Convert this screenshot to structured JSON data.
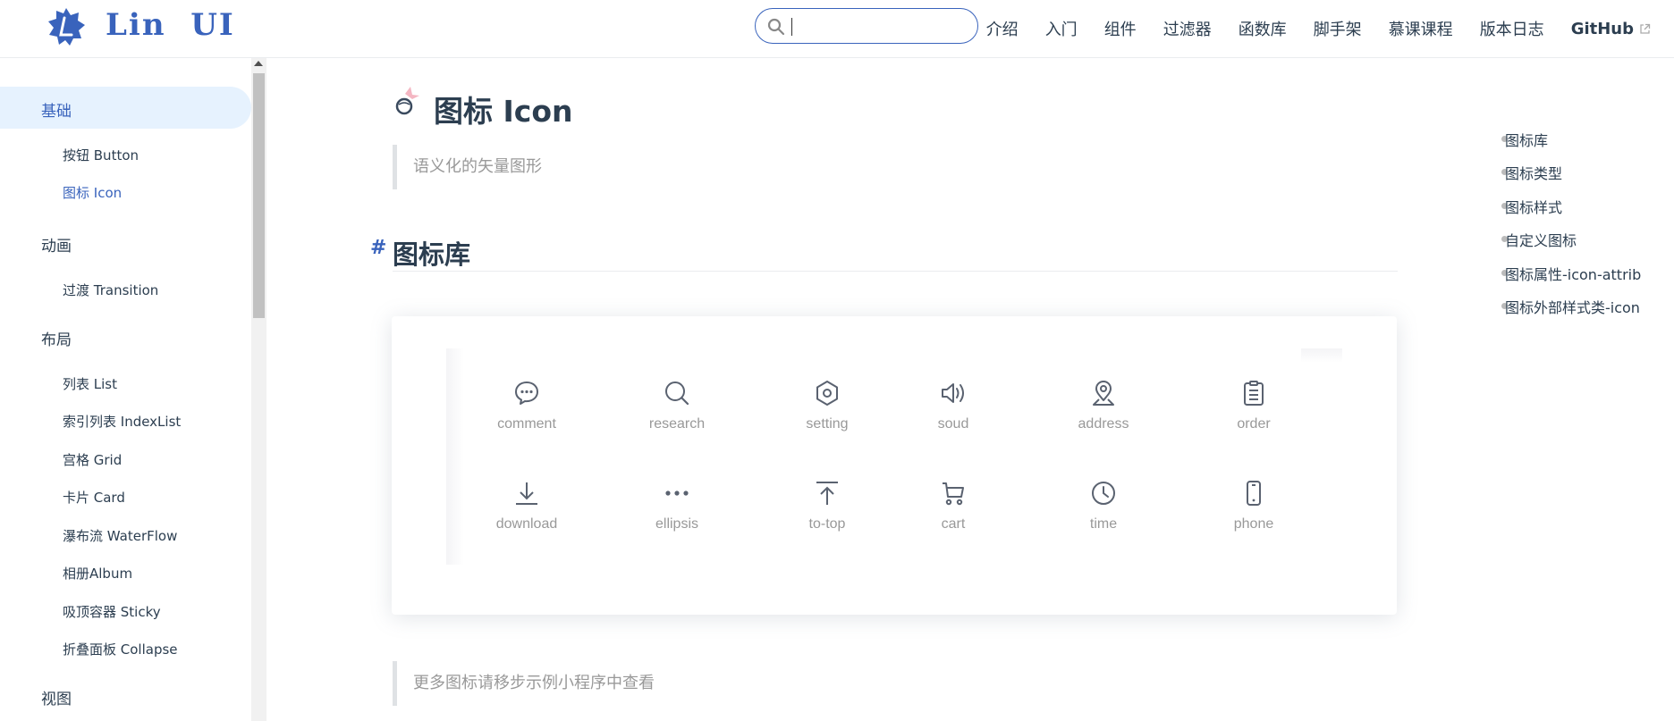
{
  "header": {
    "brand": "Lin  UI",
    "search": {
      "value": "",
      "placeholder": ""
    },
    "nav": [
      "介绍",
      "入门",
      "组件",
      "过滤器",
      "函数库",
      "脚手架",
      "慕课课程",
      "版本日志"
    ],
    "github_label": "GitHub"
  },
  "sidebar": {
    "groups": [
      {
        "title": "基础",
        "active": true,
        "items": [
          {
            "label": "按钮 Button"
          },
          {
            "label": "图标 Icon",
            "active": true
          }
        ]
      },
      {
        "title": "动画",
        "items": [
          {
            "label": "过渡 Transition"
          }
        ]
      },
      {
        "title": "布局",
        "items": [
          {
            "label": "列表 List"
          },
          {
            "label": "索引列表 IndexList"
          },
          {
            "label": "宫格 Grid"
          },
          {
            "label": "卡片 Card"
          },
          {
            "label": "瀑布流 WaterFlow"
          },
          {
            "label": "相册Album"
          },
          {
            "label": "吸顶容器 Sticky"
          },
          {
            "label": "折叠面板 Collapse"
          }
        ]
      },
      {
        "title": "视图",
        "items": []
      }
    ]
  },
  "main": {
    "title": "图标 Icon",
    "subtitle": "语义化的矢量图形",
    "section_hash": "#",
    "section_title": "图标库",
    "icons": [
      {
        "label": "comment",
        "icon": "comment-icon"
      },
      {
        "label": "research",
        "icon": "search-icon"
      },
      {
        "label": "setting",
        "icon": "setting-icon"
      },
      {
        "label": "soud",
        "icon": "sound-icon"
      },
      {
        "label": "address",
        "icon": "address-icon"
      },
      {
        "label": "order",
        "icon": "order-icon"
      },
      {
        "label": "download",
        "icon": "download-icon"
      },
      {
        "label": "ellipsis",
        "icon": "ellipsis-icon"
      },
      {
        "label": "to-top",
        "icon": "to-top-icon"
      },
      {
        "label": "cart",
        "icon": "cart-icon"
      },
      {
        "label": "time",
        "icon": "time-icon"
      },
      {
        "label": "phone",
        "icon": "phone-icon"
      }
    ],
    "note": "更多图标请移步示例小程序中查看"
  },
  "toc": [
    "图标库",
    "图标类型",
    "图标样式",
    "自定义图标",
    "图标属性-icon-attrib",
    "图标外部样式类-icon"
  ],
  "colors": {
    "accent": "#3963bc",
    "text": "#2c3e50",
    "muted": "#999999",
    "active_bg": "#e6f2fe"
  }
}
